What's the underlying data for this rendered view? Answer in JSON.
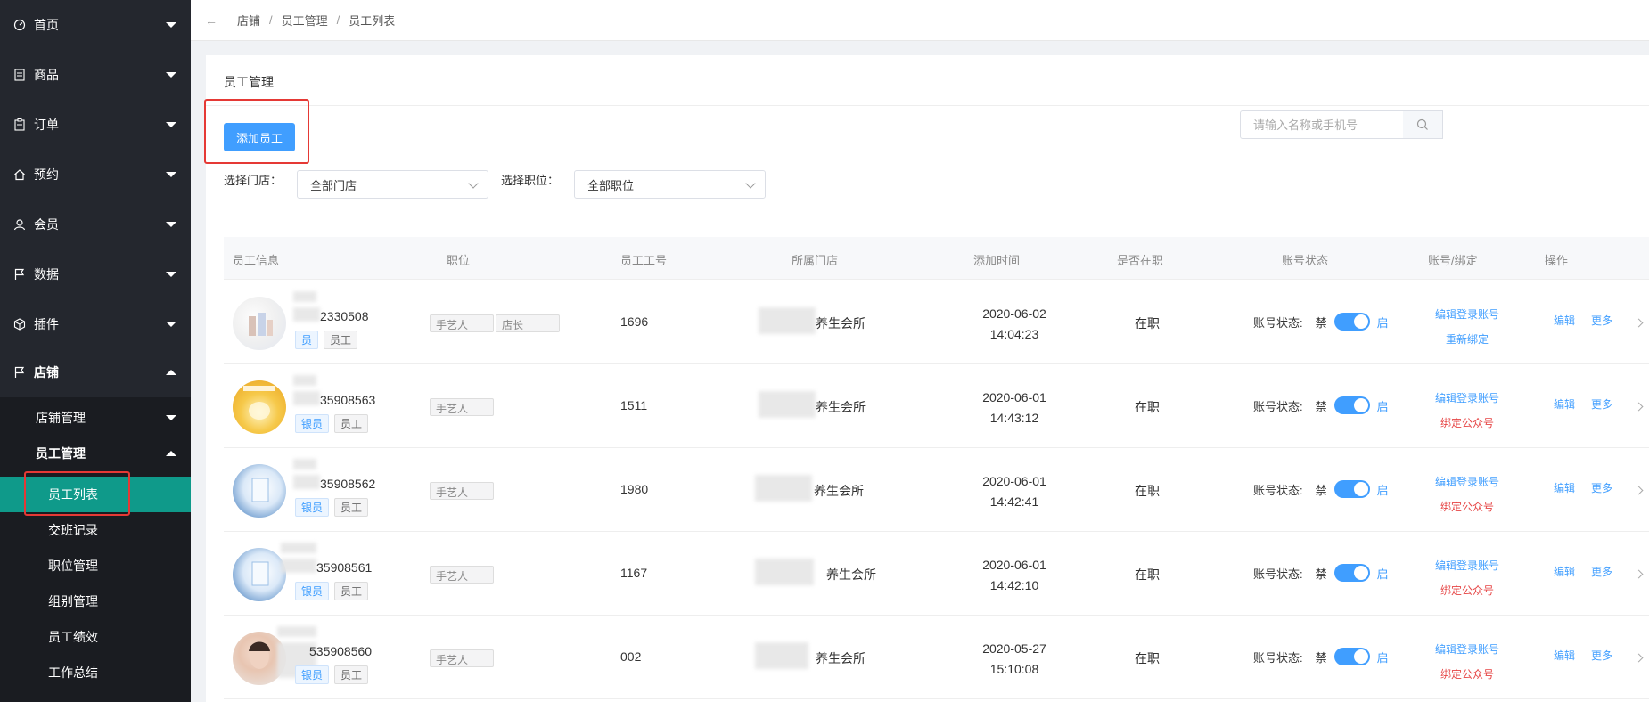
{
  "breadcrumb": {
    "items": [
      "店铺",
      "员工管理",
      "员工列表"
    ]
  },
  "sidebar": {
    "menus": [
      {
        "label": "首页",
        "icon": "dashboard-icon",
        "open": false
      },
      {
        "label": "商品",
        "icon": "document-icon",
        "open": false
      },
      {
        "label": "订单",
        "icon": "clipboard-icon",
        "open": false
      },
      {
        "label": "预约",
        "icon": "home-icon",
        "open": false
      },
      {
        "label": "会员",
        "icon": "user-icon",
        "open": false
      },
      {
        "label": "数据",
        "icon": "flag-icon",
        "open": false
      },
      {
        "label": "插件",
        "icon": "cube-icon",
        "open": false
      },
      {
        "label": "店铺",
        "icon": "flag-icon",
        "open": true
      }
    ],
    "submenus": [
      {
        "label": "店铺管理",
        "open": false
      },
      {
        "label": "员工管理",
        "open": true
      }
    ],
    "leaves": [
      "员工列表",
      "交班记录",
      "职位管理",
      "组别管理",
      "员工绩效",
      "工作总结"
    ],
    "active_leaf": "员工列表"
  },
  "card": {
    "title": "员工管理",
    "add_button": "添加员工",
    "filters": {
      "store_label": "选择门店：",
      "store_value": "全部门店",
      "position_label": "选择职位：",
      "position_value": "全部职位"
    },
    "search_placeholder": "请输入名称或手机号"
  },
  "table": {
    "headers": [
      "员工信息",
      "职位",
      "员工工号",
      "所属门店",
      "添加时间",
      "是否在职",
      "账号状态",
      "账号/绑定",
      "操作"
    ],
    "status_label": "账号状态:",
    "status_off": "禁",
    "status_on": "启",
    "edit_label": "编辑",
    "more_label": "更多",
    "rows": [
      {
        "phone": "2330508",
        "roles": [
          "员",
          "员工"
        ],
        "positions": [
          "手艺人",
          "店长"
        ],
        "emp_no": "1696",
        "store": "养生会所",
        "date": "2020-06-02",
        "time": "14:04:23",
        "employed": "在职",
        "account_link": "编辑登录账号",
        "bind_link": "重新绑定",
        "bind_color": "blue"
      },
      {
        "phone": "35908563",
        "roles": [
          "银员",
          "员工"
        ],
        "positions": [
          "手艺人"
        ],
        "emp_no": "1511",
        "store": "养生会所",
        "date": "2020-06-01",
        "time": "14:43:12",
        "employed": "在职",
        "account_link": "编辑登录账号",
        "bind_link": "绑定公众号",
        "bind_color": "red"
      },
      {
        "phone": "35908562",
        "roles": [
          "银员",
          "员工"
        ],
        "positions": [
          "手艺人"
        ],
        "emp_no": "1980",
        "store": "养生会所",
        "date": "2020-06-01",
        "time": "14:42:41",
        "employed": "在职",
        "account_link": "编辑登录账号",
        "bind_link": "绑定公众号",
        "bind_color": "red"
      },
      {
        "phone": "35908561",
        "roles": [
          "银员",
          "员工"
        ],
        "positions": [
          "手艺人"
        ],
        "emp_no": "1167",
        "store": "养生会所",
        "date": "2020-06-01",
        "time": "14:42:10",
        "employed": "在职",
        "account_link": "编辑登录账号",
        "bind_link": "绑定公众号",
        "bind_color": "red"
      },
      {
        "phone": "535908560",
        "roles": [
          "银员",
          "员工"
        ],
        "positions": [
          "手艺人"
        ],
        "emp_no": "002",
        "store": "养生会所",
        "date": "2020-05-27",
        "time": "15:10:08",
        "employed": "在职",
        "account_link": "编辑登录账号",
        "bind_link": "绑定公众号",
        "bind_color": "red"
      }
    ]
  },
  "colors": {
    "sidebar_bg": "#24272e",
    "active": "#0f9a8a",
    "primary": "#409eff",
    "danger": "#e64545",
    "highlight": "#e53935"
  }
}
